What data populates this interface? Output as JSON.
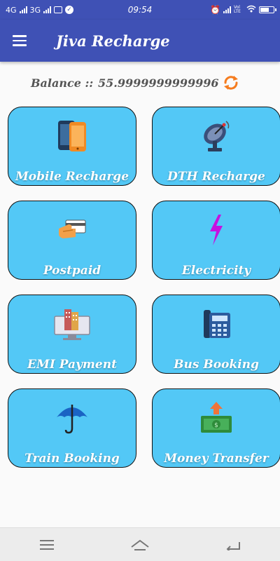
{
  "status_bar": {
    "network_left": "4G",
    "network_right": "3G",
    "time": "09:54",
    "volte": "Vol LTE"
  },
  "app_bar": {
    "title": "Jiva Recharge"
  },
  "balance": {
    "label": "Balance ::",
    "value": "55.9999999999996"
  },
  "tiles": [
    {
      "label": "Mobile Recharge",
      "icon": "mobile-phone-icon"
    },
    {
      "label": "DTH Recharge",
      "icon": "satellite-dish-icon"
    },
    {
      "label": "Postpaid",
      "icon": "card-payment-icon"
    },
    {
      "label": "Electricity",
      "icon": "lightning-icon"
    },
    {
      "label": "EMI Payment",
      "icon": "monitor-building-icon"
    },
    {
      "label": "Bus Booking",
      "icon": "phone-keypad-icon"
    },
    {
      "label": "Train Booking",
      "icon": "umbrella-icon"
    },
    {
      "label": "Money Transfer",
      "icon": "money-transfer-icon"
    }
  ],
  "colors": {
    "primary": "#3f51b5",
    "tile_bg": "#53c8f6",
    "refresh": "#f57c1f"
  }
}
